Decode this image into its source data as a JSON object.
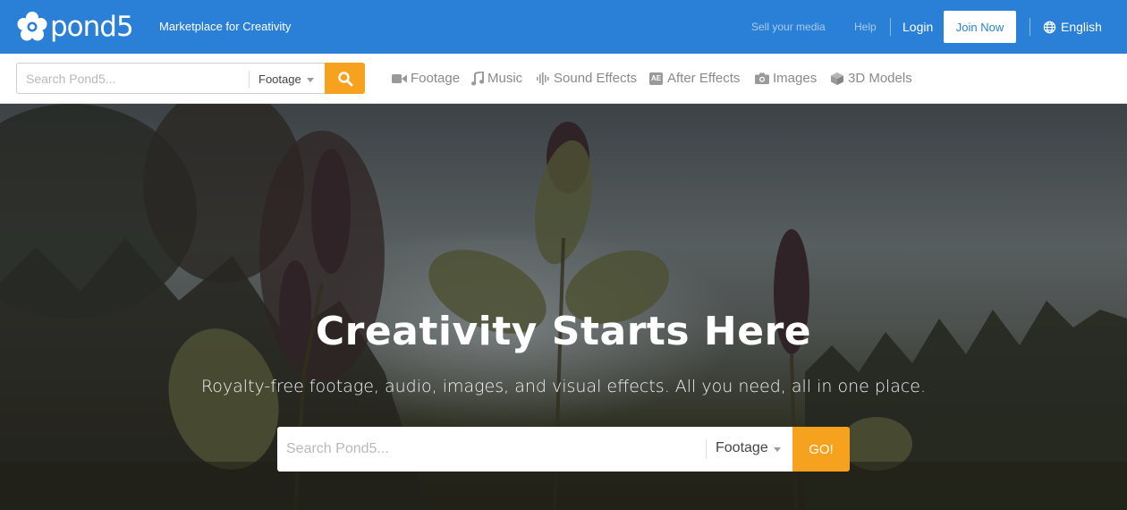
{
  "header": {
    "logo_text": "pond5",
    "tagline": "Marketplace for Creativity",
    "sell_link": "Sell your media",
    "help_link": "Help",
    "login_link": "Login",
    "join_button": "Join Now",
    "language": "English"
  },
  "navbar": {
    "search_placeholder": "Search Pond5...",
    "search_type": "Footage",
    "categories": [
      {
        "label": "Footage",
        "icon": "video-camera-icon"
      },
      {
        "label": "Music",
        "icon": "music-note-icon"
      },
      {
        "label": "Sound Effects",
        "icon": "sound-wave-icon"
      },
      {
        "label": "After Effects",
        "icon": "after-effects-icon",
        "badge": "AE"
      },
      {
        "label": "Images",
        "icon": "camera-icon"
      },
      {
        "label": "3D Models",
        "icon": "cube-icon"
      }
    ]
  },
  "hero": {
    "title": "Creativity Starts Here",
    "subtitle": "Royalty-free footage, audio, images, and visual effects. All you need, all in one place.",
    "search_placeholder": "Search Pond5...",
    "search_type": "Footage",
    "go_button": "GO!"
  },
  "colors": {
    "brand_blue": "#2a7fd6",
    "accent_orange": "#f6a21e"
  }
}
